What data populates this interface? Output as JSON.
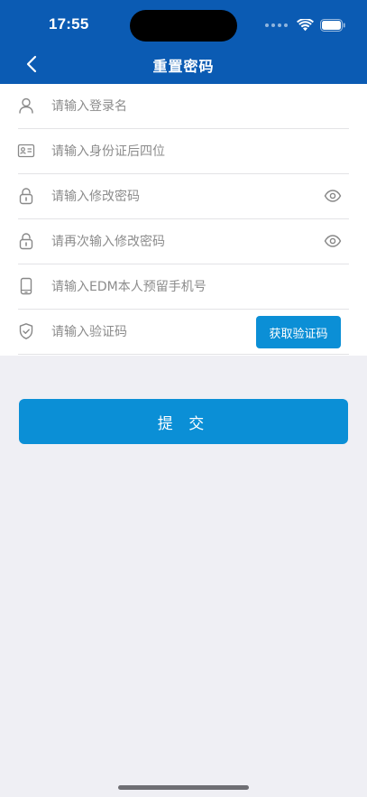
{
  "status_bar": {
    "time": "17:55",
    "icons": [
      "signal-dots-icon",
      "wifi-icon",
      "battery-icon"
    ]
  },
  "nav": {
    "back_icon": "chevron-left-icon",
    "title": "重置密码"
  },
  "form": {
    "login_name": {
      "icon": "user-icon",
      "placeholder": "请输入登录名",
      "value": ""
    },
    "id_last4": {
      "icon": "id-card-icon",
      "placeholder": "请输入身份证后四位",
      "value": ""
    },
    "new_password": {
      "icon": "lock-icon",
      "placeholder": "请输入修改密码",
      "value": "",
      "toggle_icon": "eye-icon"
    },
    "confirm_password": {
      "icon": "lock-icon",
      "placeholder": "请再次输入修改密码",
      "value": "",
      "toggle_icon": "eye-icon"
    },
    "phone": {
      "icon": "phone-icon",
      "placeholder": "请输入EDM本人预留手机号",
      "value": ""
    },
    "verify_code": {
      "icon": "shield-check-icon",
      "placeholder": "请输入验证码",
      "value": "",
      "button_label": "获取验证码"
    }
  },
  "submit_label": "提 交",
  "colors": {
    "header_bg": "#0b5bb3",
    "accent": "#0b8fd6",
    "page_bg": "#efeff4"
  }
}
